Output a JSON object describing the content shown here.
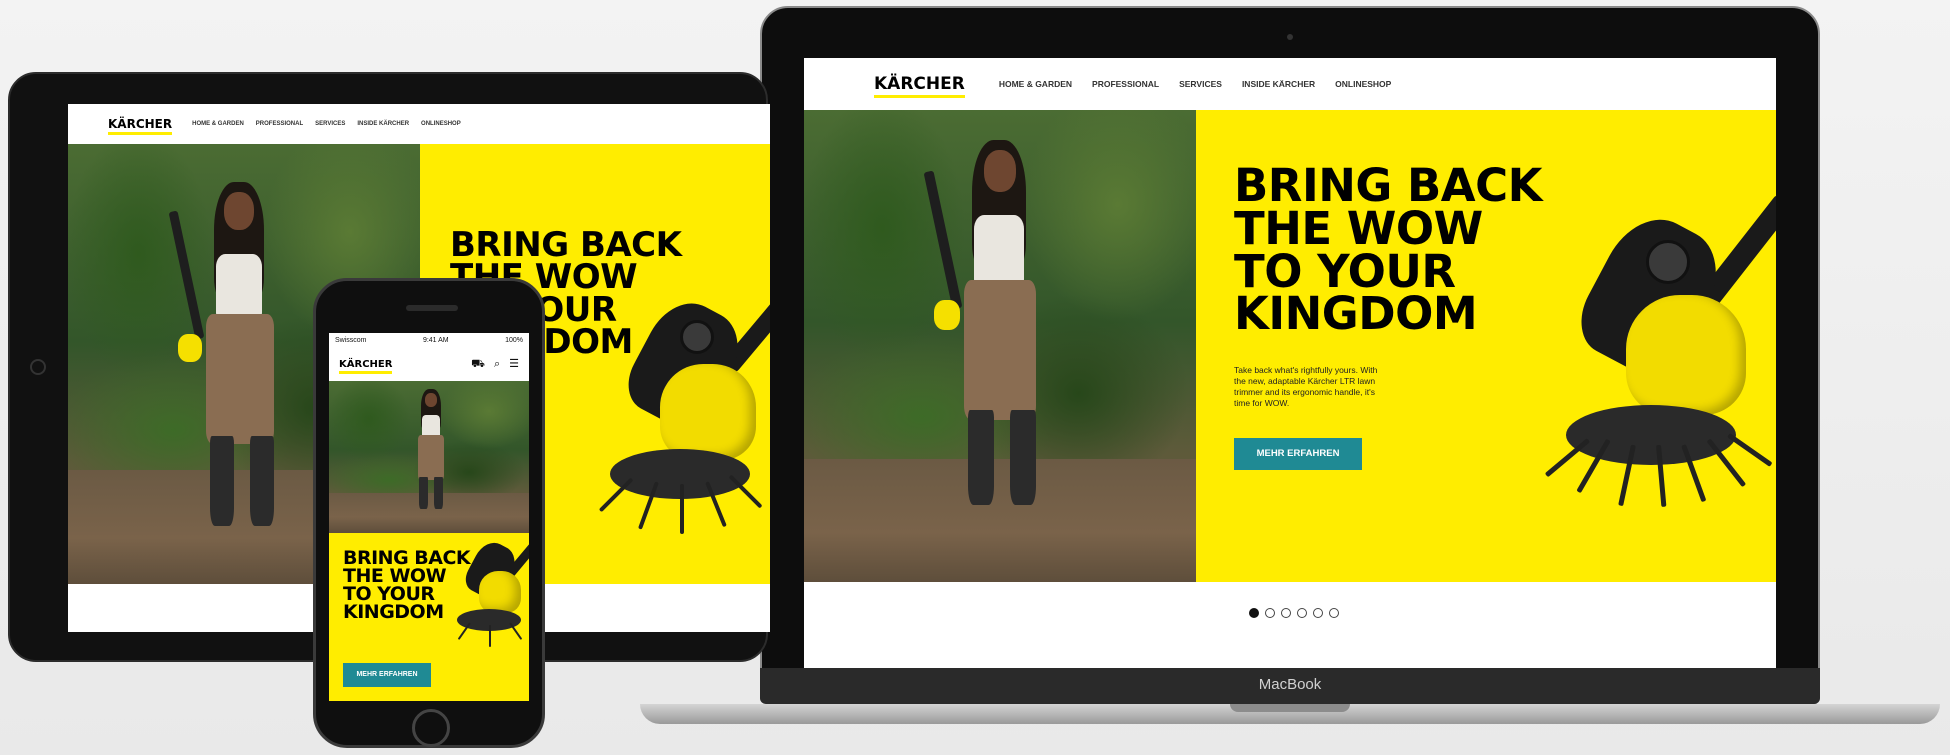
{
  "brand": {
    "logo_text": "KÄRCHER",
    "accent_color": "#ffed00",
    "cta_color": "#1f8a94"
  },
  "nav": {
    "items": [
      "HOME & GARDEN",
      "PROFESSIONAL",
      "SERVICES",
      "INSIDE KÄRCHER",
      "ONLINESHOP"
    ]
  },
  "hero": {
    "headline_lines": [
      "BRING BACK",
      "THE WOW",
      "TO YOUR",
      "KINGDOM"
    ],
    "body_lines": [
      "Take back what's rightfully yours. With",
      "the new, adaptable Kärcher LTR lawn",
      "trimmer and its ergonomic handle, it's",
      "time for WOW."
    ],
    "cta_label": "MEHR ERFAHREN"
  },
  "carousel": {
    "count": 6,
    "active_index": 0
  },
  "laptop": {
    "model_label": "MacBook"
  },
  "phone": {
    "carrier": "Swisscom",
    "time": "9:41 AM",
    "battery": "100%",
    "icons": [
      "cart-icon",
      "search-icon",
      "menu-icon"
    ]
  }
}
